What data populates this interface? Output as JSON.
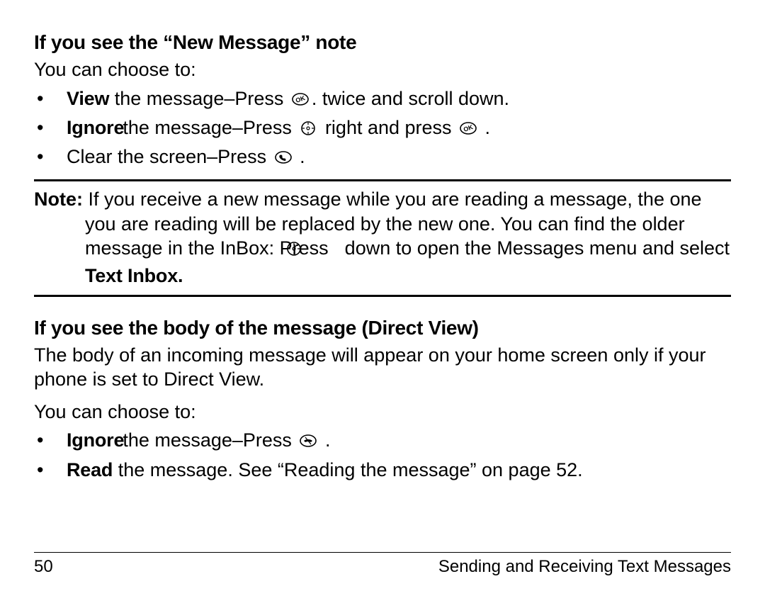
{
  "section1": {
    "heading": "If you see the “New Message” note",
    "lead": "You can choose to:",
    "items": [
      {
        "strong": "View",
        "rest1": " the message–Press ",
        "icon1": "ok",
        "rest2": ". twice and scroll down."
      },
      {
        "strong": "Ignore",
        "rest1": "the message–Press ",
        "icon1": "nav",
        "rest2": " right and press ",
        "icon2": "ok",
        "rest3": " ."
      },
      {
        "strong": "",
        "rest1": "Clear the screen–Press ",
        "icon1": "phone",
        "rest2": " ."
      }
    ]
  },
  "note": {
    "label": "Note:",
    "part1": " If you receive a new message while you are reading a message, the one you are reading will be replaced by the new one. You can find the older message in the InBox: Press ",
    "icon": "nav",
    "part2": " down to open the Messages menu and select ",
    "strong_tail": "Text Inbox."
  },
  "section2": {
    "heading": "If you see the body of the message (Direct View)",
    "para": "The body of an incoming message will appear on your home screen only if your phone is set to Direct View.",
    "lead": "You can choose to:",
    "items": [
      {
        "strong": "Ignore",
        "rest1": "the message–Press ",
        "icon1": "end",
        "rest2": " ."
      },
      {
        "strong": "Read",
        "rest1": " the message. See “Reading the message” on page 52."
      }
    ]
  },
  "footer": {
    "page_number": "50",
    "chapter": "Sending and Receiving Text Messages"
  },
  "icons": {
    "ok": "ok-key-icon",
    "nav": "nav-key-icon",
    "phone": "phone-key-icon",
    "end": "end-call-icon"
  }
}
